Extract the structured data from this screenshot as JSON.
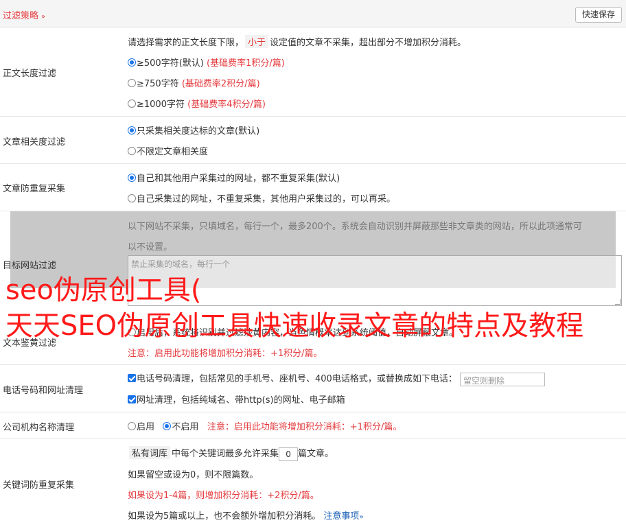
{
  "header": {
    "title": "过滤策略",
    "chevron": "»",
    "save_label": "快速保存"
  },
  "length_filter": {
    "label": "正文长度过滤",
    "desc_pre": "请选择需求的正文长度下限，",
    "desc_tag": "小于",
    "desc_post": "设定值的文章不采集，超出部分不增加积分消耗。",
    "options": [
      {
        "text": "≥500字符(默认)",
        "note": "(基础费率1积分/篇)",
        "selected": true
      },
      {
        "text": "≥750字符",
        "note": "(基础费率2积分/篇)",
        "selected": false
      },
      {
        "text": "≥1000字符",
        "note": "(基础费率4积分/篇)",
        "selected": false
      }
    ]
  },
  "relevance_filter": {
    "label": "文章相关度过滤",
    "options": [
      {
        "text": "只采集相关度达标的文章(默认)",
        "selected": true
      },
      {
        "text": "不限定文章相关度",
        "selected": false
      }
    ]
  },
  "dedupe": {
    "label": "文章防重复采集",
    "options": [
      {
        "text": "自己和其他用户采集过的网址，都不重复采集(默认)",
        "selected": true
      },
      {
        "text": "自己采集过的网址，不重复采集，其他用户采集过的，可以再采。",
        "selected": false
      }
    ]
  },
  "site_filter": {
    "label": "目标网站过滤",
    "desc_line1": "以下网站不采集，只填域名，每行一个，最多200个。系统会自动识别并屏蔽那些非文章类的网站，所以此项通常可",
    "desc_line2": "以不设置。",
    "placeholder": "禁止采集的域名，每行一个"
  },
  "porn_filter": {
    "label": "文本鉴黄过滤",
    "line": "启用后，系统将识别并过滤涉黄内容，当色情概率达到系统阈值，自动屏蔽文章。",
    "note": "注意：启用此功能将增加积分消耗：+1积分/篇。"
  },
  "phone_url": {
    "label": "电话号码和网址清理",
    "phone_text": "电话号码清理，包括常见的手机号、座机号、400电话格式，或替换成如下电话：",
    "phone_placeholder": "留空则删除",
    "url_text": "网址清理，包括纯域名、带http(s)的网址、电子邮箱"
  },
  "org_name": {
    "label": "公司机构名称清理",
    "enable": "启用",
    "disable": "不启用",
    "note": "注意：启用此功能将增加积分消耗：+1积分/篇。"
  },
  "keyword_dedupe": {
    "label": "关键词防重复采集",
    "tag": "私有词库",
    "line1_mid": "中每个关键词最多允许采集",
    "value": "0",
    "line1_post": "篇文章。",
    "line2": "如果留空或设为0，则不限篇数。",
    "line3": "如果设为1-4篇，则增加积分消耗：+2积分/篇。",
    "line4": "如果设为5篇或以上，也不会额外增加积分消耗。",
    "link": "注意事项",
    "link_chev": "»"
  },
  "watermark": {
    "line1": "seo伪原创工具(",
    "line2": "天天SEO伪原创工具快速收录文章的特点及教程"
  },
  "colors": {
    "accent_red": "#e4393c",
    "radio_blue": "#1a73e8",
    "watermark_red": "#ff1a1a"
  }
}
